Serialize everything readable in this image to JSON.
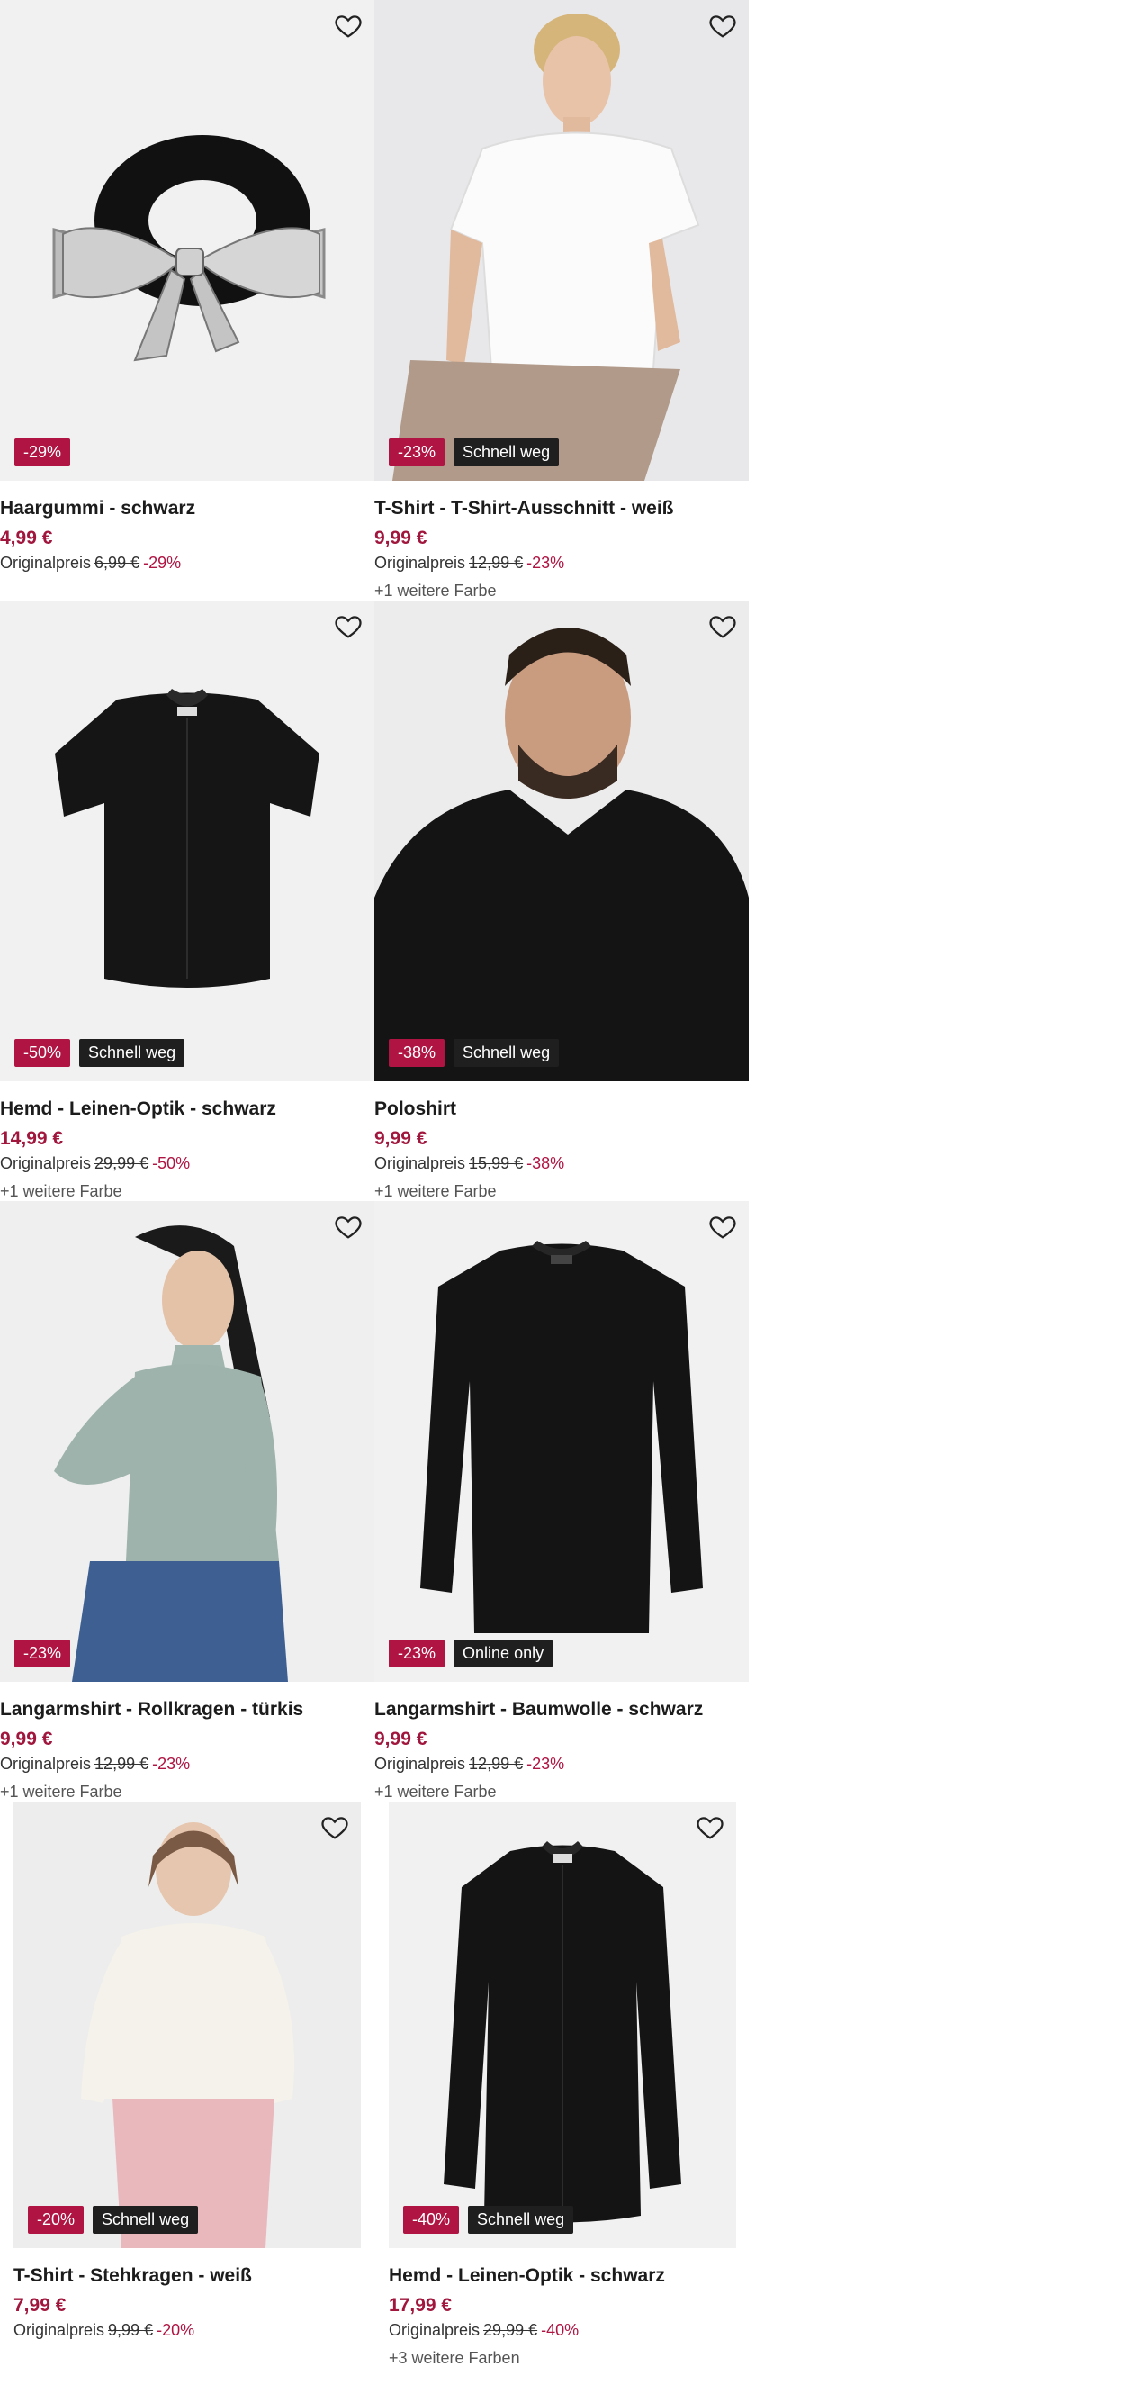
{
  "products": [
    {
      "title": "Haargummi - schwarz",
      "price": "4,99 €",
      "orig_label": "Originalpreis",
      "orig_price": "6,99 €",
      "discount": "-29%",
      "badge": "-29%",
      "tag": "",
      "colors": ""
    },
    {
      "title": "T-Shirt - T-Shirt-Ausschnitt - weiß",
      "price": "9,99 €",
      "orig_label": "Originalpreis",
      "orig_price": "12,99 €",
      "discount": "-23%",
      "badge": "-23%",
      "tag": "Schnell weg",
      "colors": "+1 weitere Farbe"
    },
    {
      "title": "Hemd - Leinen-Optik - schwarz",
      "price": "14,99 €",
      "orig_label": "Originalpreis",
      "orig_price": "29,99 €",
      "discount": "-50%",
      "badge": "-50%",
      "tag": "Schnell weg",
      "colors": "+1 weitere Farbe"
    },
    {
      "title": "Poloshirt",
      "price": "9,99 €",
      "orig_label": "Originalpreis",
      "orig_price": "15,99 €",
      "discount": "-38%",
      "badge": "-38%",
      "tag": "Schnell weg",
      "colors": "+1 weitere Farbe"
    },
    {
      "title": "Langarmshirt - Rollkragen - türkis",
      "price": "9,99 €",
      "orig_label": "Originalpreis",
      "orig_price": "12,99 €",
      "discount": "-23%",
      "badge": "-23%",
      "tag": "",
      "colors": "+1 weitere Farbe"
    },
    {
      "title": "Langarmshirt - Baumwolle - schwarz",
      "price": "9,99 €",
      "orig_label": "Originalpreis",
      "orig_price": "12,99 €",
      "discount": "-23%",
      "badge": "-23%",
      "tag": "Online only",
      "colors": "+1 weitere Farbe"
    },
    {
      "title": "T-Shirt - Stehkragen - weiß",
      "price": "7,99 €",
      "orig_label": "Originalpreis",
      "orig_price": "9,99 €",
      "discount": "-20%",
      "badge": "-20%",
      "tag": "Schnell weg",
      "colors": ""
    },
    {
      "title": "Hemd - Leinen-Optik - schwarz",
      "price": "17,99 €",
      "orig_label": "Originalpreis",
      "orig_price": "29,99 €",
      "discount": "-40%",
      "badge": "-40%",
      "tag": "Schnell weg",
      "colors": "+3 weitere Farben"
    }
  ],
  "icons": {
    "wishlist": "heart-outline-icon"
  },
  "colors": {
    "price": "#a0163d",
    "discount_badge": "#b01442",
    "tag_badge": "#1f1f1f"
  }
}
